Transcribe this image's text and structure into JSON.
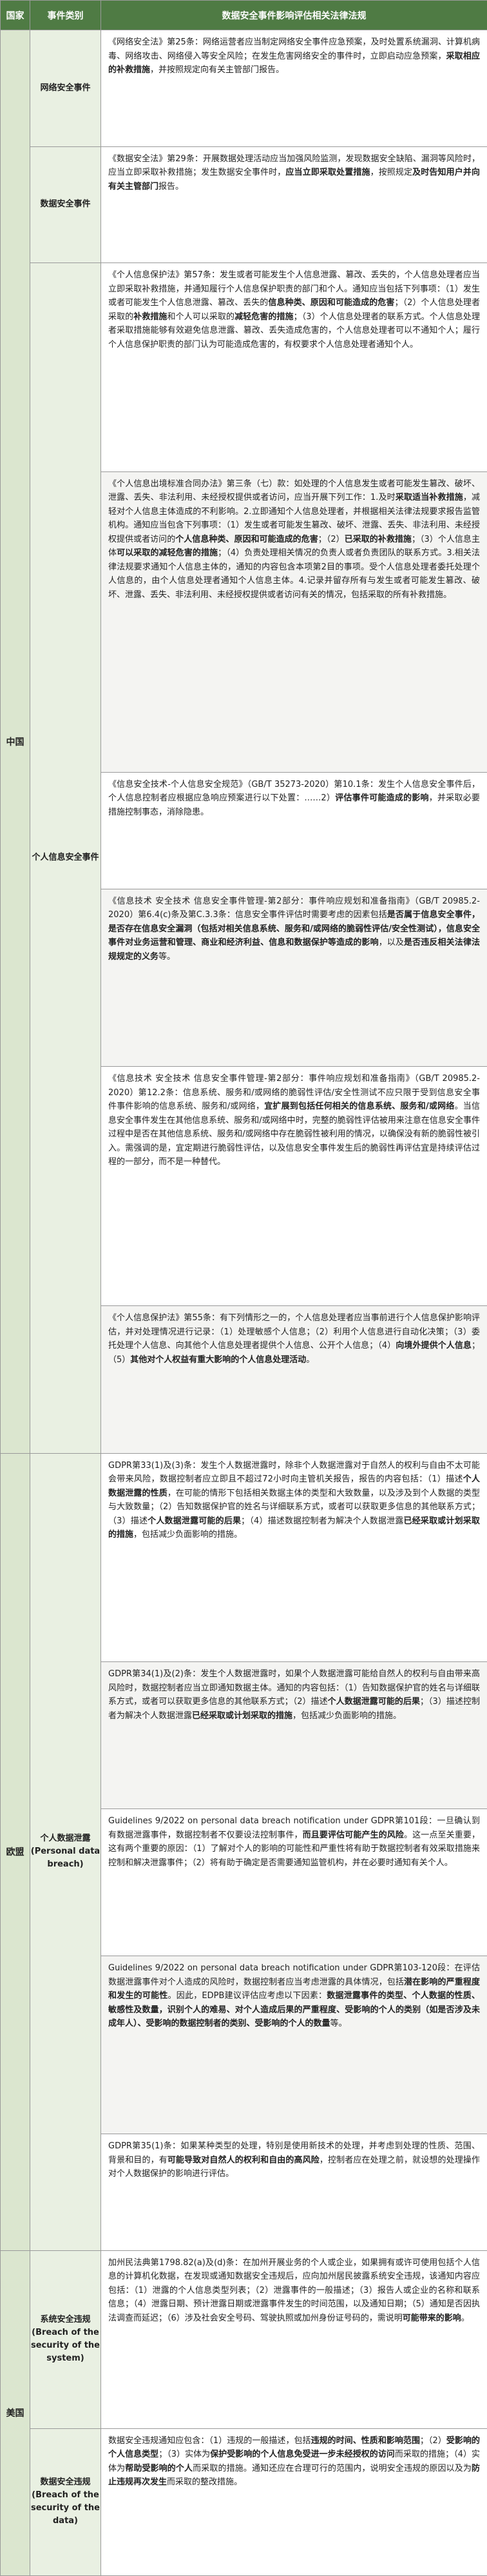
{
  "header": {
    "country": "国家",
    "category": "事件类别",
    "law": "数据安全事件影响评估相关法律法规"
  },
  "regions": [
    {
      "country": "中国",
      "groups": [
        {
          "category": "网络安全事件",
          "laws": [
            {
              "segments": [
                {
                  "text": "《网络安全法》第25条：网络运营者应当制定网络安全事件应急预案，及时处置系统漏洞、计算机病毒、网络攻击、网络侵入等安全风险；在发生危害网络安全的事件时，立即启动应急预案，"
                },
                {
                  "text": "采取相应的补救措施",
                  "bold": true
                },
                {
                  "text": "，并按照规定向有关主管部门报告。"
                }
              ]
            }
          ]
        },
        {
          "category": "数据安全事件",
          "laws": [
            {
              "segments": [
                {
                  "text": "《数据安全法》第29条：开展数据处理活动应当加强风险监测，发现数据安全缺陷、漏洞等风险时，应当立即采取补救措施；发生数据安全事件时，"
                },
                {
                  "text": "应当立即采取处置措施",
                  "bold": true
                },
                {
                  "text": "，按照规定"
                },
                {
                  "text": "及时告知用户并向有关主管部门",
                  "bold": true
                },
                {
                  "text": "报告。"
                }
              ]
            }
          ]
        },
        {
          "category": "个人信息安全事件",
          "laws": [
            {
              "segments": [
                {
                  "text": "《个人信息保护法》第57条：发生或者可能发生个人信息泄露、篡改、丢失的，个人信息处理者应当立即采取补救措施，并通知履行个人信息保护职责的部门和个人。通知应当包括下列事项："
                },
                {
                  "text": "（1）发生或者可能发生个人信息泄露、篡改、丢失的"
                },
                {
                  "text": "信息种类、原因和可能造成的危害",
                  "bold": true
                },
                {
                  "text": "；（2）个人信息处理者采取的"
                },
                {
                  "text": "补救措施",
                  "bold": true
                },
                {
                  "text": "和个人可以采取的"
                },
                {
                  "text": "减轻危害的措施",
                  "bold": true
                },
                {
                  "text": "；（3）个人信息处理者的联系方式。个人信息处理者采取措施能够有效避免信息泄露、篡改、丢失造成危害的，个人信息处理者可以不通知个人；履行个人信息保护职责的部门认为可能造成危害的，有权要求个人信息处理者通知个人。"
                }
              ]
            },
            {
              "segments": [
                {
                  "text": "《个人信息出境标准合同办法》第三条（七）款：如处理的个人信息发生或者可能发生篡改、破坏、泄露、丢失、非法利用、未经授权提供或者访问，应当开展下列工作：1.及时"
                },
                {
                  "text": "采取适当补救措施",
                  "bold": true
                },
                {
                  "text": "，减轻对个人信息主体造成的不利影响。2.立即通知个人信息处理者，并根据相关法律法规要求报告监管机构。通知应当包含下列事项：（1）发生或者可能发生篡改、破坏、泄露、丢失、非法利用、未经授权提供或者访问的"
                },
                {
                  "text": "个人信息种类、原因和可能造成的危害",
                  "bold": true
                },
                {
                  "text": "；（2）"
                },
                {
                  "text": "已采取的补救措施",
                  "bold": true
                },
                {
                  "text": "；（3）个人信息主体"
                },
                {
                  "text": "可以采取的减轻危害的措施",
                  "bold": true
                },
                {
                  "text": "；（4）负责处理相关情况的负责人或者负责团队的联系方式。3.相关法律法规要求通知个人信息主体的，通知的内容包含本项第2目的事项。受个人信息处理者委托处理个人信息的，由个人信息处理者通知个人信息主体。4.记录并留存所有与发生或者可能发生篡改、破坏、泄露、丢失、非法利用、未经授权提供或者访问有关的情况，包括采取的所有补救措施。"
                }
              ]
            },
            {
              "segments": [
                {
                  "text": "《信息安全技术-个人信息安全规范》（GB/T 35273-2020）第10.1条：发生个人信息安全事件后，个人信息控制者应根据应急响应预案进行以下处置：……2）"
                },
                {
                  "text": "评估事件可能造成的影响",
                  "bold": true
                },
                {
                  "text": "，并采取必要措施控制事态，消除隐患。"
                }
              ]
            },
            {
              "segments": [
                {
                  "text": "《信息技术 安全技术 信息安全事件管理-第2部分：事件响应规划和准备指南》（GB/T 20985.2-2020）第6.4(c)条及第C.3.3条：信息安全事件评估时需要考虑的因素包括"
                },
                {
                  "text": "是否属于信息安全事件，是否存在信息安全漏洞（包括对相关信息系统、服务和/或网络的脆弱性评估/安全性测试），信息安全事件对业务运营和管理、商业和经济利益、信息和数据保护等造成的影响",
                  "bold": true
                },
                {
                  "text": "，以及"
                },
                {
                  "text": "是否违反相关法律法规规定的义务",
                  "bold": true
                },
                {
                  "text": "等。"
                }
              ]
            },
            {
              "segments": [
                {
                  "text": "《信息技术 安全技术 信息安全事件管理-第2部分：事件响应规划和准备指南》（GB/T 20985.2-2020）第12.2条：信息系统、服务和/或网络的脆弱性评估/安全性测试不应只限于受到信息安全事件事件影响的信息系统、服务和/或网络，"
                },
                {
                  "text": "宜扩展到包括任何相关的信息系统、服务和/或网络",
                  "bold": true
                },
                {
                  "text": "。当信息安全事件发生在其他信息系统、服务和/或网络中时，完整的脆弱性评估被用来注意在信息安全事件过程中是否在其他信息系统、服务和/或网络中存在脆弱性被利用的情况，以确保没有新的脆弱性被引入。需强调的是，宜定期进行脆弱性评估，以及信息安全事件发生后的脆弱性再评估宜是持续评估过程的一部分，而不是一种替代。"
                }
              ]
            },
            {
              "segments": [
                {
                  "text": "《个人信息保护法》第55条：有下列情形之一的，个人信息处理者应当事前进行个人信息保护影响评估，并对处理情况进行记录：（1）处理敏感个人信息；（2）利用个人信息进行自动化决策；（3）委托处理个人信息、向其他个人信息处理者提供个人信息、公开个人信息；（4）"
                },
                {
                  "text": "向境外提供个人信息",
                  "bold": true
                },
                {
                  "text": "；（5）"
                },
                {
                  "text": "其他对个人权益有重大影响的个人信息处理活动",
                  "bold": true
                },
                {
                  "text": "。"
                }
              ]
            }
          ]
        }
      ]
    },
    {
      "country": "欧盟",
      "groups": [
        {
          "category": "个人数据泄露 (Personal data breach)",
          "laws": [
            {
              "segments": [
                {
                  "text": "GDPR第33(1)及(3)条：发生个人数据泄露时，除非个人数据泄露对于自然人的权利与自由不太可能会带来风险，数据控制者应立即且不超过72小时向主管机关报告，报告的内容包括：（1）描述"
                },
                {
                  "text": "个人数据泄露的性质",
                  "bold": true
                },
                {
                  "text": "，在可能的情形下包括相关数据主体的类型和大致数量，以及涉及到个人数据的类型与大致数量；（2）告知数据保护官的姓名与详细联系方式，或者可以获取更多信息的其他联系方式；（3）描述"
                },
                {
                  "text": "个人数据泄露可能的后果",
                  "bold": true
                },
                {
                  "text": "；（4）描述数据控制者为解决个人数据泄露"
                },
                {
                  "text": "已经采取或计划采取的措施",
                  "bold": true
                },
                {
                  "text": "，包括减少负面影响的措施。"
                }
              ]
            },
            {
              "segments": [
                {
                  "text": "GDPR第34(1)及(2)条：发生个人数据泄露时，如果个人数据泄露可能给自然人的权利与自由带来高风险时，数据控制者应当立即通知数据主体。通知的内容包括：（1）告知数据保护官的姓名与详细联系方式，或者可以获取更多信息的其他联系方式；（2）描述"
                },
                {
                  "text": "个人数据泄露可能的后果",
                  "bold": true
                },
                {
                  "text": "；（3）描述控制者为解决个人数据泄露"
                },
                {
                  "text": "已经采取或计划采取的措施",
                  "bold": true
                },
                {
                  "text": "，包括减少负面影响的措施。"
                }
              ]
            },
            {
              "segments": [
                {
                  "text": "Guidelines 9/2022 on personal data breach notification under GDPR第101段：一旦确认到有数据泄露事件，数据控制者不仅要设法控制事件，"
                },
                {
                  "text": "而且要评估可能产生的风险",
                  "bold": true
                },
                {
                  "text": "。这一点至关重要，这有两个重要的原因：（1）了解对个人的影响的可能性和严重性将有助于数据控制者有效采取措施来控制和解决泄露事件；（2）将有助于确定是否需要通知监管机构，并在必要时通知有关个人。"
                }
              ]
            },
            {
              "segments": [
                {
                  "text": "Guidelines 9/2022 on personal data breach notification under GDPR第103-120段：在评估数据泄露事件对个人造成的风险时，数据控制者应当考虑泄露的具体情况，包括"
                },
                {
                  "text": "潜在影响的严重程度和发生的可能性",
                  "bold": true
                },
                {
                  "text": "。因此，EDPB建议评估应考虑以下因素："
                },
                {
                  "text": "数据泄露事件的类型、个人数据的性质、敏感性及数量，识别个人的难易、对个人造成后果的严重程度、受影响的个人的类别（如是否涉及未成年人）、受影响的数据控制者的类别、受影响的个人的数量",
                  "bold": true
                },
                {
                  "text": "等。"
                }
              ]
            },
            {
              "segments": [
                {
                  "text": "GDPR第35(1)条：如果某种类型的处理，特别是使用新技术的处理，并考虑到处理的性质、范围、背景和目的，有"
                },
                {
                  "text": "可能导致对自然人的权利和自由的高风险",
                  "bold": true
                },
                {
                  "text": "，控制者应在处理之前，就设想的处理操作对个人数据保护的影响进行评估。"
                }
              ]
            }
          ]
        }
      ]
    },
    {
      "country": "美国",
      "groups": [
        {
          "category": "系统安全违规 (Breach of the security of the system)",
          "laws": [
            {
              "segments": [
                {
                  "text": "加州民法典第1798.82(a)及(d)条：在加州开展业务的个人或企业，如果拥有或许可使用包括个人信息的计算机化数据，在发现或通知数据安全违规后，应向加州居民披露系统安全违规，该通知内容应包括：（1）泄露的个人信息类型列表；（2）泄露事件的一般描述；（3）报告人或企业的名称和联系信息；（4）泄露日期、预计泄露日期或泄露事件发生的时间范围，以及通知日期；（5）通知是否因执法调查而延迟；（6）涉及社会安全号码、驾驶执照或加州身份证号码的，需说明"
                },
                {
                  "text": "可能带来的影响",
                  "bold": true
                },
                {
                  "text": "。"
                }
              ]
            }
          ]
        },
        {
          "category": "数据安全违规 (Breach of the security of the data)",
          "laws": [
            {
              "segments": [
                {
                  "text": "数据安全违规通知应包含：（1）违规的一般描述，包括"
                },
                {
                  "text": "违规的时间、性质和影响范围",
                  "bold": true
                },
                {
                  "text": "；（2）"
                },
                {
                  "text": "受影响的个人信息类型",
                  "bold": true
                },
                {
                  "text": "；（3）实体为"
                },
                {
                  "text": "保护受影响的个人信息免受进一步未经授权的访问",
                  "bold": true
                },
                {
                  "text": "而采取的措施；（4）实体为"
                },
                {
                  "text": "帮助受影响的个人",
                  "bold": true
                },
                {
                  "text": "而采取的措施。通知还应在合理可行的范围内，说明安全违规的原因以及为"
                },
                {
                  "text": "防止违规再次发生",
                  "bold": true
                },
                {
                  "text": "而采取的整改措施。"
                }
              ]
            }
          ]
        }
      ]
    }
  ]
}
